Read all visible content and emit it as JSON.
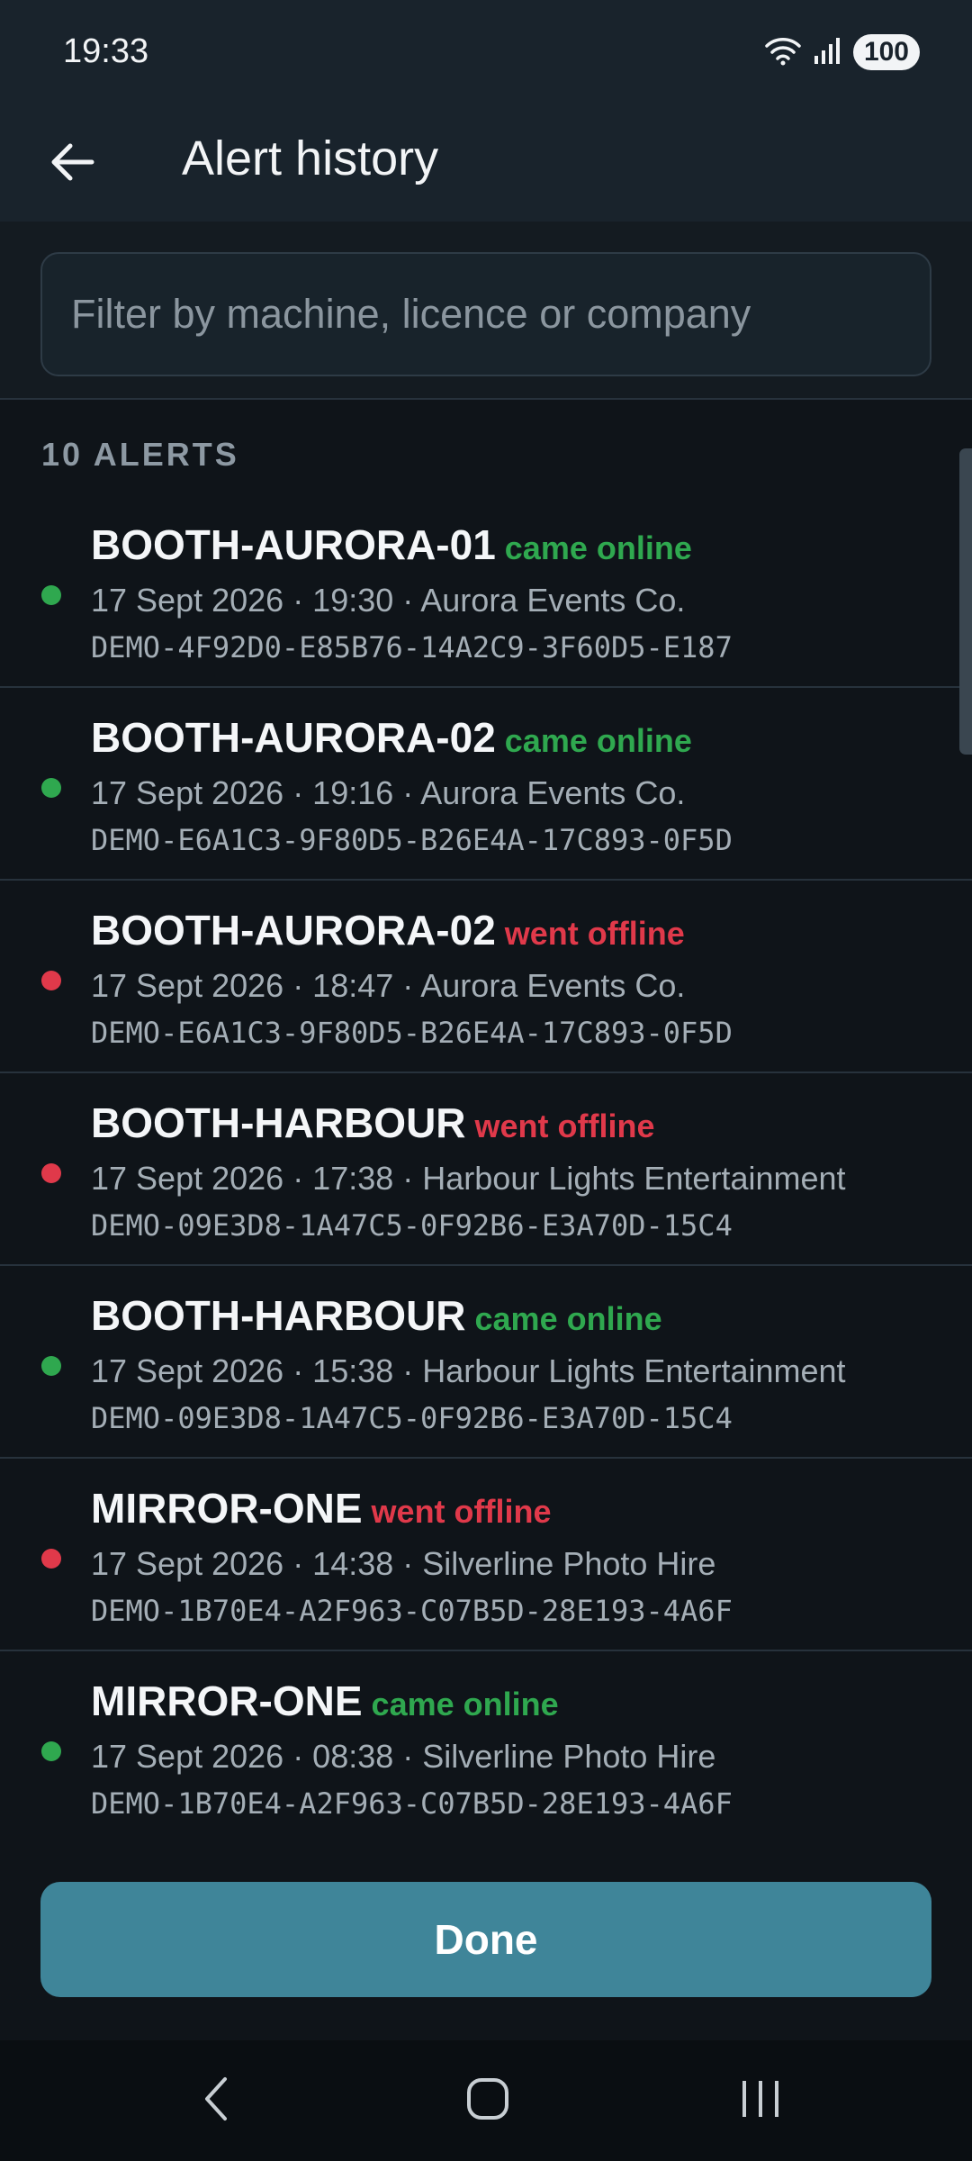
{
  "status_bar": {
    "time": "19:33",
    "battery": "100"
  },
  "app_bar": {
    "title": "Alert history"
  },
  "filter": {
    "placeholder": "Filter by machine, licence or company"
  },
  "list_header": "10 ALERTS",
  "alerts": [
    {
      "machine": "BOOTH-AURORA-01",
      "event": "came online",
      "status": "online",
      "meta": "17 Sept 2026 · 19:30 · Aurora Events Co.",
      "licence": "DEMO-4F92D0-E85B76-14A2C9-3F60D5-E187"
    },
    {
      "machine": "BOOTH-AURORA-02",
      "event": "came online",
      "status": "online",
      "meta": "17 Sept 2026 · 19:16 · Aurora Events Co.",
      "licence": "DEMO-E6A1C3-9F80D5-B26E4A-17C893-0F5D"
    },
    {
      "machine": "BOOTH-AURORA-02",
      "event": "went offline",
      "status": "offline",
      "meta": "17 Sept 2026 · 18:47 · Aurora Events Co.",
      "licence": "DEMO-E6A1C3-9F80D5-B26E4A-17C893-0F5D"
    },
    {
      "machine": "BOOTH-HARBOUR",
      "event": "went offline",
      "status": "offline",
      "meta": "17 Sept 2026 · 17:38 · Harbour Lights Entertainment",
      "licence": "DEMO-09E3D8-1A47C5-0F92B6-E3A70D-15C4"
    },
    {
      "machine": "BOOTH-HARBOUR",
      "event": "came online",
      "status": "online",
      "meta": "17 Sept 2026 · 15:38 · Harbour Lights Entertainment",
      "licence": "DEMO-09E3D8-1A47C5-0F92B6-E3A70D-15C4"
    },
    {
      "machine": "MIRROR-ONE",
      "event": "went offline",
      "status": "offline",
      "meta": "17 Sept 2026 · 14:38 · Silverline Photo Hire",
      "licence": "DEMO-1B70E4-A2F963-C07B5D-28E193-4A6F"
    },
    {
      "machine": "MIRROR-ONE",
      "event": "came online",
      "status": "online",
      "meta": "17 Sept 2026 · 08:38 · Silverline Photo Hire",
      "licence": "DEMO-1B70E4-A2F963-C07B5D-28E193-4A6F"
    }
  ],
  "footer": {
    "done_label": "Done"
  },
  "colors": {
    "online": "#2fa84f",
    "offline": "#e0394a",
    "accent": "#3f8599",
    "background": "#0f1419",
    "app_bar": "#19232c"
  },
  "icons": {
    "back": "arrow-left-icon",
    "wifi": "wifi-icon",
    "signal": "signal-icon",
    "nav_back": "chevron-left-icon",
    "nav_home": "home-icon",
    "nav_recents": "recents-icon"
  }
}
